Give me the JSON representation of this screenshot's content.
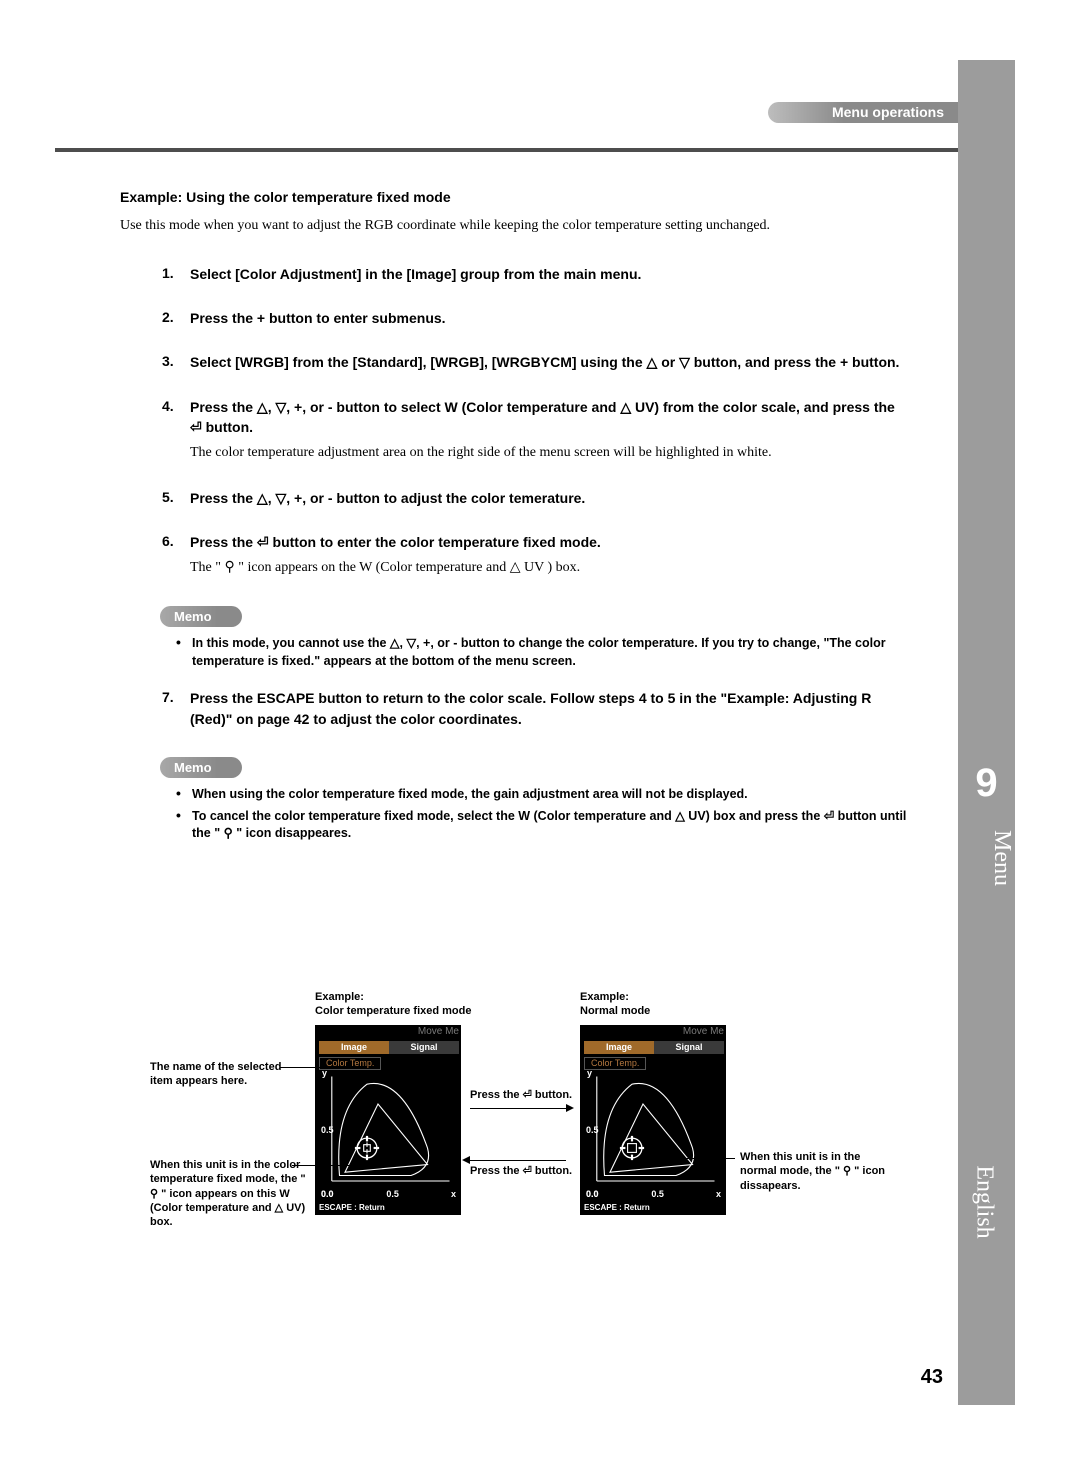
{
  "header": {
    "section": "Menu operations"
  },
  "side": {
    "chapter_number": "9",
    "chapter_title": "Menu",
    "language": "English"
  },
  "page_number": "43",
  "example_heading": "Example: Using the color temperature fixed mode",
  "example_intro": "Use this mode when you want to adjust the RGB coordinate while keeping the color temperature setting unchanged.",
  "steps": [
    {
      "n": "1.",
      "text": "Select [Color Adjustment] in the [Image] group from the main menu."
    },
    {
      "n": "2.",
      "text": "Press the + button to enter submenus."
    },
    {
      "n": "3.",
      "text": "Select  [WRGB] from the [Standard], [WRGB], [WRGBYCM] using the △ or ▽ button, and press the + button."
    },
    {
      "n": "4.",
      "text": "Press the △, ▽, +, or - button to select W (Color temperature and △ UV)  from the color scale, and press the ⏎ button.",
      "sub": "The color temperature adjustment area on the right side of the menu screen will be highlighted in white."
    },
    {
      "n": "5.",
      "text": "Press the △, ▽, +, or - button to adjust the color temerature."
    },
    {
      "n": "6.",
      "text": "Press the ⏎ button to enter the color temperature fixed mode.",
      "sub": "The \" ⚲ \" icon appears on the W (Color temperature and △ UV ) box."
    }
  ],
  "memo1_label": "Memo",
  "memo1_items": [
    "In this mode, you cannot use the △, ▽, +, or - button to change the color temperature. If you try to change, \"The color temperature is fixed.\" appears at the bottom of the menu screen."
  ],
  "step7": {
    "n": "7.",
    "text": "Press the ESCAPE button to return to the color scale. Follow steps 4 to 5 in the \"Example: Adjusting R (Red)\" on page 42 to adjust the color coordinates."
  },
  "memo2_label": "Memo",
  "memo2_items": [
    "When using the color temperature fixed mode, the gain adjustment area will not be displayed.",
    "To cancel the color temperature fixed mode, select the W (Color temperature and △ UV) box and press the ⏎ button until the \" ⚲ \" icon disappeares."
  ],
  "figures": {
    "left": {
      "caption": "Example:\nColor temperature fixed mode",
      "move": "Move Me",
      "tabs": {
        "image": "Image",
        "signal": "Signal"
      },
      "crumb": "Color Temp.",
      "y_label": "y",
      "x_label": "x",
      "tick_y": "0.5",
      "tick_x0": "0.0",
      "tick_x1": "0.5",
      "tick_y0": "0.0",
      "escape": "ESCAPE : Return",
      "cursor_mode": "locked"
    },
    "right": {
      "caption": "Example:\nNormal mode",
      "move": "Move Me",
      "tabs": {
        "image": "Image",
        "signal": "Signal"
      },
      "crumb": "Color Temp.",
      "y_label": "y",
      "x_label": "x",
      "tick_y": "0.5",
      "tick_x0": "0.0",
      "tick_x1": "0.5",
      "tick_y0": "0.0",
      "escape": "ESCAPE : Return",
      "cursor_mode": "normal"
    },
    "annot": {
      "name_here": "The name of the selected item appears here.",
      "fixed_icon": "When this unit is in the color temperature fixed mode, the \" ⚲ \" icon appears on this W (Color temperature and △ UV) box.",
      "press_enter": "Press the ⏎ button.",
      "normal_icon": "When this unit is in the normal mode, the \" ⚲ \" icon dissapears."
    }
  }
}
